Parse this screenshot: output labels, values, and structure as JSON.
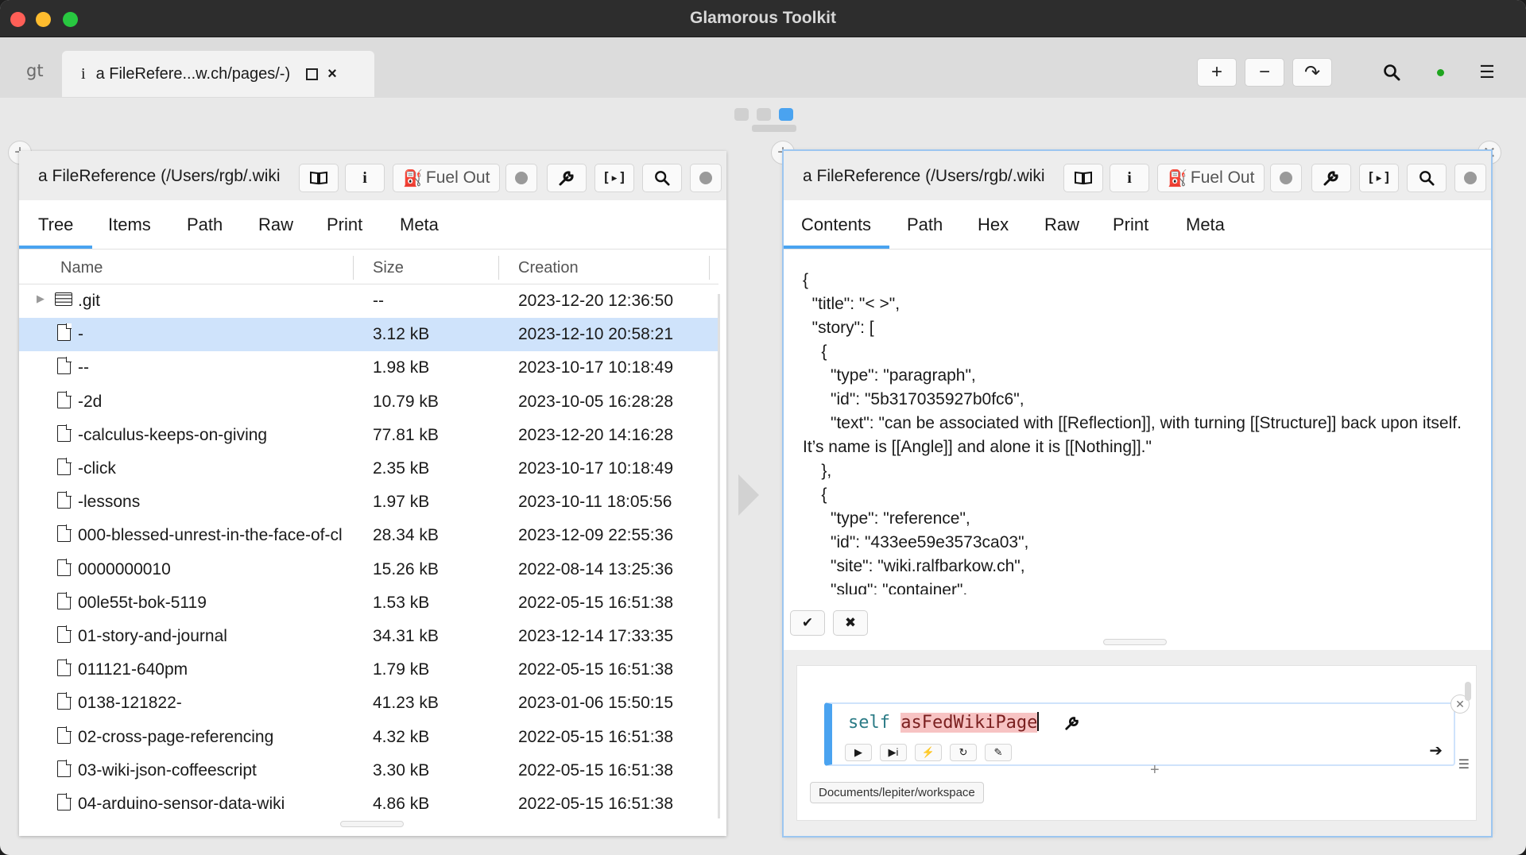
{
  "window": {
    "title": "Glamorous Toolkit"
  },
  "tabstrip": {
    "logo": "gt",
    "tab_icon": "i",
    "tab_label": "a FileRefere...w.ch/pages/-)",
    "tab_close": "×",
    "add_label": "+",
    "minus_label": "−",
    "share_label": "↷",
    "search_icon": "search-icon",
    "menu_icon": "☰",
    "status_color": "#1fa51f"
  },
  "left_pane": {
    "title": "a FileReference (/Users/rgb/.wiki",
    "fuel_label": "Fuel Out",
    "tabs": [
      "Tree",
      "Items",
      "Path",
      "Raw",
      "Print",
      "Meta"
    ],
    "active_tab": "Tree",
    "columns": {
      "name": "Name",
      "size": "Size",
      "creation": "Creation"
    },
    "rows": [
      {
        "name": ".git",
        "size": "--",
        "created": "2023-12-20 12:36:50",
        "kind": "folder"
      },
      {
        "name": "-",
        "size": "3.12 kB",
        "created": "2023-12-10 20:58:21",
        "kind": "file",
        "selected": true
      },
      {
        "name": "--",
        "size": "1.98 kB",
        "created": "2023-10-17 10:18:49",
        "kind": "file"
      },
      {
        "name": "-2d",
        "size": "10.79 kB",
        "created": "2023-10-05 16:28:28",
        "kind": "file"
      },
      {
        "name": "-calculus-keeps-on-giving",
        "size": "77.81 kB",
        "created": "2023-12-20 14:16:28",
        "kind": "file"
      },
      {
        "name": "-click",
        "size": "2.35 kB",
        "created": "2023-10-17 10:18:49",
        "kind": "file"
      },
      {
        "name": "-lessons",
        "size": "1.97 kB",
        "created": "2023-10-11 18:05:56",
        "kind": "file"
      },
      {
        "name": "000-blessed-unrest-in-the-face-of-cl",
        "size": "28.34 kB",
        "created": "2023-12-09 22:55:36",
        "kind": "file"
      },
      {
        "name": "0000000010",
        "size": "15.26 kB",
        "created": "2022-08-14 13:25:36",
        "kind": "file"
      },
      {
        "name": "00le55t-bok-5119",
        "size": "1.53 kB",
        "created": "2022-05-15 16:51:38",
        "kind": "file"
      },
      {
        "name": "01-story-and-journal",
        "size": "34.31 kB",
        "created": "2023-12-14 17:33:35",
        "kind": "file"
      },
      {
        "name": "011121-640pm",
        "size": "1.79 kB",
        "created": "2022-05-15 16:51:38",
        "kind": "file"
      },
      {
        "name": "0138-121822-",
        "size": "41.23 kB",
        "created": "2023-01-06 15:50:15",
        "kind": "file"
      },
      {
        "name": "02-cross-page-referencing",
        "size": "4.32 kB",
        "created": "2022-05-15 16:51:38",
        "kind": "file"
      },
      {
        "name": "03-wiki-json-coffeescript",
        "size": "3.30 kB",
        "created": "2022-05-15 16:51:38",
        "kind": "file"
      },
      {
        "name": "04-arduino-sensor-data-wiki",
        "size": "4.86 kB",
        "created": "2022-05-15 16:51:38",
        "kind": "file"
      }
    ]
  },
  "right_pane": {
    "title": "a FileReference (/Users/rgb/.wiki",
    "fuel_label": "Fuel Out",
    "tabs": [
      "Contents",
      "Path",
      "Hex",
      "Raw",
      "Print",
      "Meta"
    ],
    "active_tab": "Contents",
    "contents": "{\n  \"title\": \"< >\",\n  \"story\": [\n    {\n      \"type\": \"paragraph\",\n      \"id\": \"5b317035927b0fc6\",\n      \"text\": \"can be associated with [[Reflection]], with turning [[Structure]] back upon itself. It’s name is [[Angle]] and alone it is [[Nothing]].\"\n    },\n    {\n      \"type\": \"reference\",\n      \"id\": \"433ee59e3573ca03\",\n      \"site\": \"wiki.ralfbarkow.ch\",\n      \"slug\": \"container\",",
    "accept_label": "✔",
    "cancel_label": "✖",
    "snippet": {
      "receiver": "self",
      "selector": "asFedWikiPage"
    },
    "path_chip": "Documents/lepiter/workspace"
  }
}
